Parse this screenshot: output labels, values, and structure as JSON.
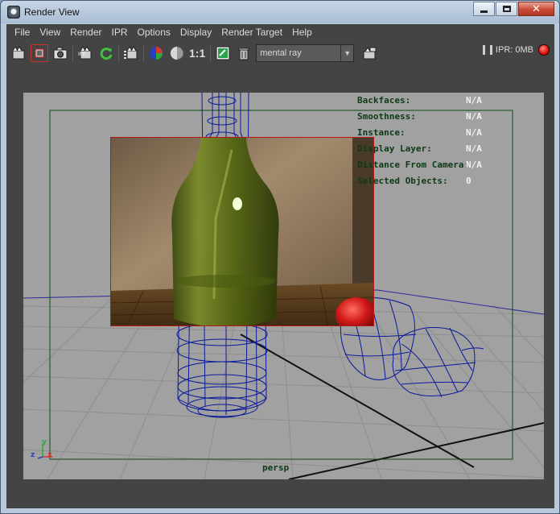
{
  "window": {
    "title": "Render View"
  },
  "menu": [
    "File",
    "View",
    "Render",
    "IPR",
    "Options",
    "Display",
    "Render Target",
    "Help"
  ],
  "toolbar": {
    "icons": [
      "render-frame-icon",
      "render-region-icon",
      "snapshot-icon",
      "ipr-render-icon",
      "refresh-ipr-icon",
      "render-sequence-icon",
      "color-channels-icon",
      "alpha-channel-icon",
      "real-size-icon",
      "keep-image-icon",
      "remove-image-icon"
    ],
    "real_size_label": "1:1",
    "renderer": "mental ray",
    "ipr_memory": "IPR: 0MB"
  },
  "hud": [
    {
      "label": "Backfaces:",
      "value": "N/A"
    },
    {
      "label": "Smoothness:",
      "value": "N/A"
    },
    {
      "label": "Instance:",
      "value": "N/A"
    },
    {
      "label": "Display Layer:",
      "value": "N/A"
    },
    {
      "label": "Distance From Camera:",
      "value": "N/A"
    },
    {
      "label": "Selected Objects:",
      "value": "0"
    }
  ],
  "viewport": {
    "camera": "persp",
    "axes": {
      "x": "x",
      "y": "y",
      "z": "z"
    },
    "colors": {
      "wireframe": "#0a1a9a",
      "grid": "#8e8e8e",
      "resolution_gate": "#0e4a18",
      "region_border": "#b21a1a"
    }
  }
}
